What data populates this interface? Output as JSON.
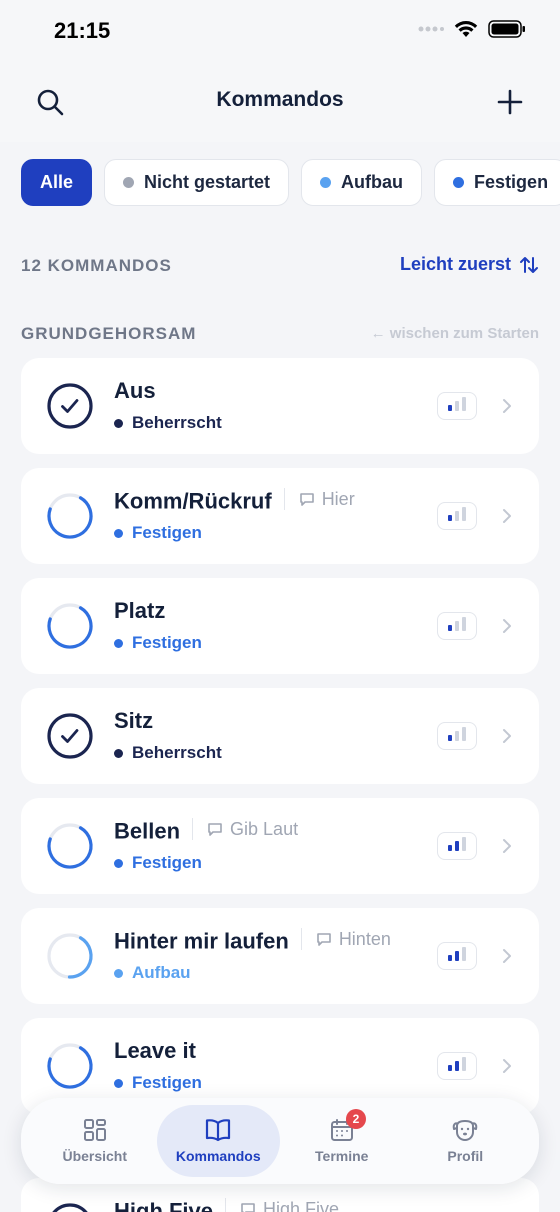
{
  "status_bar": {
    "time": "21:15"
  },
  "header": {
    "title": "Kommandos"
  },
  "filters": [
    {
      "label": "Alle",
      "active": true,
      "dot_color": ""
    },
    {
      "label": "Nicht gestartet",
      "active": false,
      "dot_color": "#a0a6b3"
    },
    {
      "label": "Aufbau",
      "active": false,
      "dot_color": "#5aa2f0"
    },
    {
      "label": "Festigen",
      "active": false,
      "dot_color": "#2f6fe0"
    }
  ],
  "summary": {
    "count_label": "12 KOMMANDOS",
    "sort_label": "Leicht zuerst"
  },
  "section": {
    "title": "GRUNDGEHORSAM",
    "hint": "← wischen zum Starten"
  },
  "commands": [
    {
      "name": "Aus",
      "alias": "",
      "status": "Beherrscht",
      "state": "mastered",
      "difficulty": 1
    },
    {
      "name": "Komm/Rückruf",
      "alias": "Hier",
      "status": "Festigen",
      "state": "festigen",
      "difficulty": 1
    },
    {
      "name": "Platz",
      "alias": "",
      "status": "Festigen",
      "state": "festigen",
      "difficulty": 1
    },
    {
      "name": "Sitz",
      "alias": "",
      "status": "Beherrscht",
      "state": "mastered",
      "difficulty": 1
    },
    {
      "name": "Bellen",
      "alias": "Gib Laut",
      "status": "Festigen",
      "state": "festigen",
      "difficulty": 2
    },
    {
      "name": "Hinter mir laufen",
      "alias": "Hinten",
      "status": "Aufbau",
      "state": "aufbau",
      "difficulty": 2
    },
    {
      "name": "Leave it",
      "alias": "",
      "status": "Festigen",
      "state": "festigen",
      "difficulty": 2
    }
  ],
  "partial_command": {
    "name": "High Five",
    "alias": "High Five"
  },
  "colors": {
    "accent": "#1f3fbf",
    "mastered": "#1b2550",
    "festigen": "#2f6fe0",
    "aufbau": "#5aa2f0",
    "badge": "#e5484d"
  },
  "tabbar": [
    {
      "label": "Übersicht",
      "icon": "grid-icon",
      "active": false
    },
    {
      "label": "Kommandos",
      "icon": "book-icon",
      "active": true
    },
    {
      "label": "Termine",
      "icon": "calendar-icon",
      "active": false,
      "badge": "2"
    },
    {
      "label": "Profil",
      "icon": "dog-face-icon",
      "active": false
    }
  ]
}
